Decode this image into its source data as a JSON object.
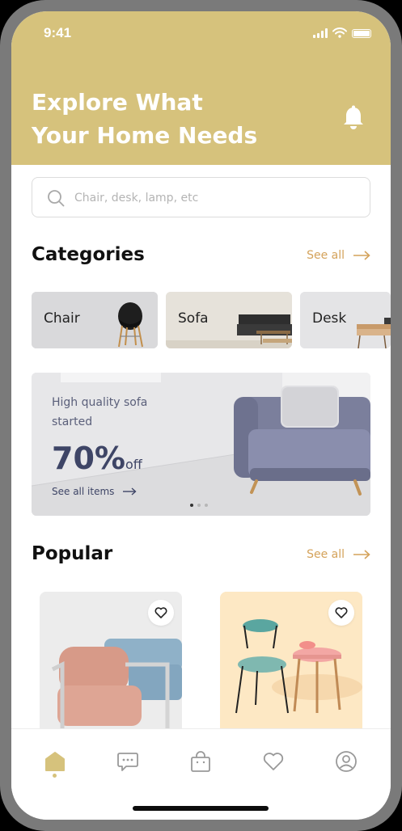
{
  "status_bar": {
    "time": "9:41"
  },
  "header": {
    "title_line1": "Explore What",
    "title_line2": "Your Home Needs",
    "notification_icon": "bell-icon",
    "background_color": "#d6c27c"
  },
  "search": {
    "placeholder": "Chair, desk, lamp, etc",
    "value": ""
  },
  "categories": {
    "title": "Categories",
    "see_all": "See all",
    "items": [
      {
        "label": "Chair"
      },
      {
        "label": "Sofa"
      },
      {
        "label": "Desk"
      }
    ]
  },
  "promo": {
    "subtitle": "High quality sofa started",
    "discount": "70%",
    "discount_suffix": "off",
    "link": "See all items",
    "slides_total": 3,
    "slide_active": 1
  },
  "popular": {
    "title": "Popular",
    "see_all": "See all"
  },
  "bottom_nav": {
    "items": [
      "home-icon",
      "chat-icon",
      "bag-icon",
      "heart-icon",
      "profile-icon"
    ],
    "active": "home-icon"
  },
  "colors": {
    "accent": "#d4a25a",
    "brand": "#d6c27c",
    "text_dark": "#3e4566"
  }
}
